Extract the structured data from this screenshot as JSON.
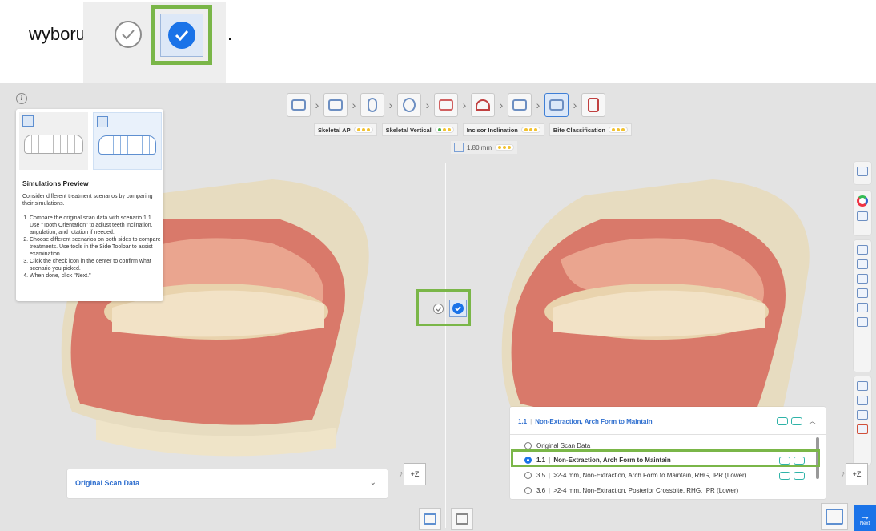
{
  "caption": {
    "word": "wyboru",
    "period": "."
  },
  "toolbar": {
    "steps": [
      "tooth-segmentation",
      "arch-setup",
      "tooth-single",
      "face-profile",
      "landmarks",
      "arch-form",
      "ipr",
      "simulations",
      "report"
    ],
    "active_index": 7
  },
  "status": {
    "chips": [
      {
        "label": "Skeletal AP",
        "dots": [
          "#f2c230",
          "#f2c230",
          "#f2c230"
        ]
      },
      {
        "label": "Skeletal Vertical",
        "dots": [
          "#48b04a",
          "#f2c230",
          "#f2c230"
        ]
      },
      {
        "label": "Incisor Inclination",
        "dots": [
          "#f2c230",
          "#f2c230",
          "#f2c230"
        ]
      },
      {
        "label": "Bite Classification",
        "dots": [
          "#f2c230",
          "#f2c230",
          "#f2c230"
        ]
      }
    ],
    "measure": "1.80 mm",
    "measure_dots": [
      "#f2c230",
      "#f2c230",
      "#f2c230"
    ]
  },
  "help": {
    "title": "Simulations Preview",
    "intro": "Consider different treatment scenarios by comparing their simulations.",
    "steps": [
      "Compare the original scan data with scenario 1.1. Use \"Tooth Orientation\" to adjust teeth inclination, angulation, and rotation if needed.",
      "Choose different scenarios on both sides to compare treatments. Use tools in the Side Toolbar to assist examination.",
      "Click the check icon in the center to confirm what scenario you picked.",
      "When done, click \"Next.\""
    ]
  },
  "left_dropdown": {
    "label": "Original Scan Data"
  },
  "view_cube": {
    "label": "+Z"
  },
  "scenario_panel": {
    "header_num": "1.1",
    "header_label": "Non-Extraction, Arch Form to Maintain",
    "options": [
      {
        "num": "",
        "label": "Original Scan Data",
        "selected": false
      },
      {
        "num": "1.1",
        "label": "Non-Extraction, Arch Form to Maintain",
        "selected": true
      },
      {
        "num": "3.5",
        "label": ">2-4 mm, Non-Extraction, Arch Form to Maintain, RHG, IPR (Lower)",
        "selected": false
      },
      {
        "num": "3.6",
        "label": ">2-4 mm, Non-Extraction, Posterior Crossbite, RHG, IPR (Lower)",
        "selected": false
      }
    ]
  },
  "next": {
    "label": "Next",
    "arrow": "→"
  },
  "colors": {
    "accent": "#1a73e8",
    "highlight": "#7ab648",
    "background": "#e3e3e3"
  }
}
